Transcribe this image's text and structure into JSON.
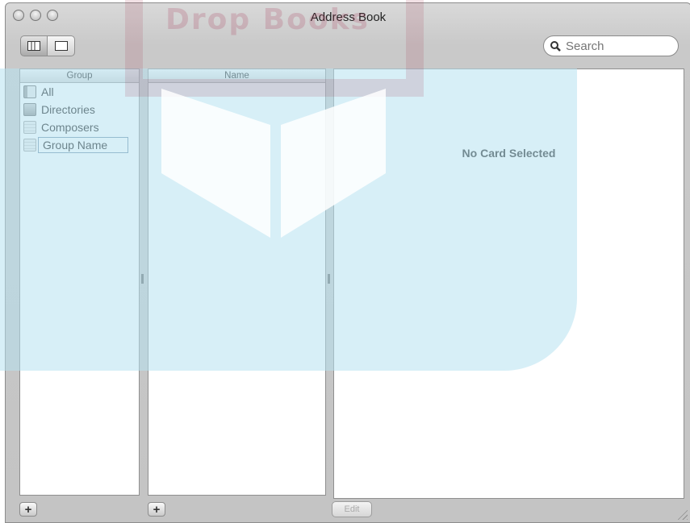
{
  "window": {
    "title": "Address Book"
  },
  "toolbar": {
    "view_buttons": [
      "card-and-columns-view-icon",
      "card-only-view-icon"
    ],
    "search_placeholder": "Search"
  },
  "columns": {
    "group_header": "Group",
    "name_header": "Name"
  },
  "groups": [
    {
      "label": "All",
      "icon": "address-book-icon"
    },
    {
      "label": "Directories",
      "icon": "directories-icon"
    },
    {
      "label": "Composers",
      "icon": "group-icon"
    },
    {
      "label": "Group Name",
      "icon": "group-icon",
      "editing": true
    }
  ],
  "card": {
    "empty_text": "No Card Selected"
  },
  "bottom_bar": {
    "add_group": "+",
    "add_person": "+",
    "edit_label": "Edit"
  },
  "watermark": {
    "text": "Drop Books"
  },
  "colors": {
    "window_bg": "#c4c4c4",
    "watermark_blue": "#b6e2f0",
    "watermark_red": "#aa3c5a"
  }
}
